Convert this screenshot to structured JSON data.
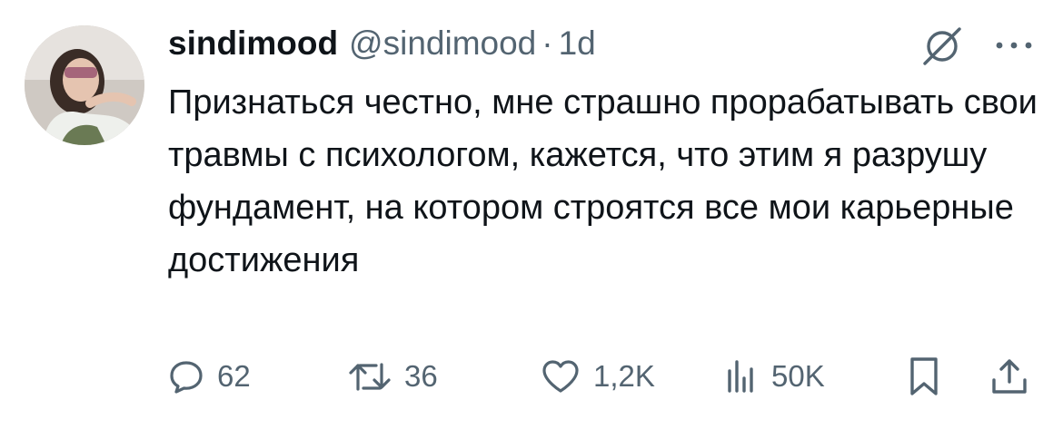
{
  "user": {
    "display_name": "sindimood",
    "handle": "@sindimood",
    "separator": "·",
    "time": "1d"
  },
  "tweet": {
    "text": "Признаться честно, мне страшно прорабатывать свои травмы с психологом, кажется, что этим я разрушу фундамент, на котором строятся все мои карьерные достижения"
  },
  "actions": {
    "replies": "62",
    "reposts": "36",
    "likes": "1,2K",
    "views": "50K"
  },
  "icons": {
    "grok": "grok-icon",
    "more": "more-icon",
    "reply": "reply-icon",
    "repost": "repost-icon",
    "like": "like-icon",
    "views": "views-icon",
    "bookmark": "bookmark-icon",
    "share": "share-icon"
  },
  "colors": {
    "text_primary": "#0f1419",
    "text_secondary": "#536471",
    "background": "#ffffff"
  }
}
